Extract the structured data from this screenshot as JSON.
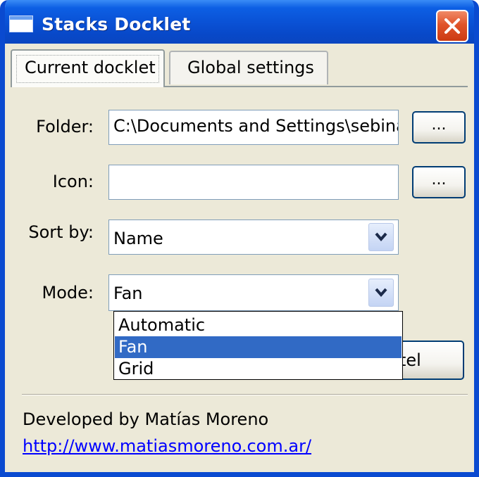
{
  "window": {
    "title": "Stacks Docklet",
    "icon": "window-icon",
    "close_icon": "close-icon"
  },
  "tabs": [
    {
      "label": "Current docklet",
      "active": true
    },
    {
      "label": "Global settings",
      "active": false
    }
  ],
  "form": {
    "folder": {
      "label": "Folder:",
      "value": "C:\\Documents and Settings\\sebina",
      "browse_label": "..."
    },
    "icon": {
      "label": "Icon:",
      "value": "",
      "browse_label": "..."
    },
    "sort_by": {
      "label": "Sort by:",
      "value": "Name"
    },
    "mode": {
      "label": "Mode:",
      "value": "Fan",
      "options": [
        "Automatic",
        "Fan",
        "Grid"
      ],
      "highlighted": "Fan"
    }
  },
  "buttons": {
    "cancel_visible_label": "tel"
  },
  "footer": {
    "credit": "Developed by Matías Moreno",
    "link": "http://www.matiasmoreno.com.ar/"
  },
  "colors": {
    "titlebar": "#0a52d6",
    "window_bg": "#ece9d8",
    "selection": "#316ac5",
    "close_button": "#e0542a",
    "link": "#0000ff"
  }
}
